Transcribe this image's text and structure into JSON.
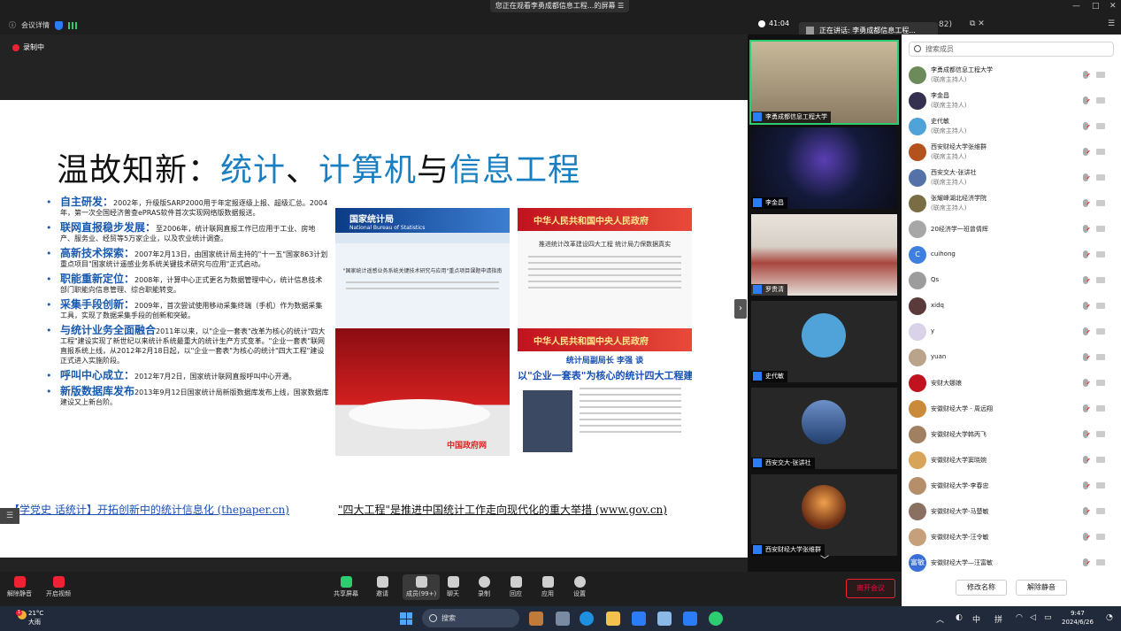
{
  "window": {
    "share_banner": "您正在观看李勇成都信息工程...的屏幕 ☰",
    "meeting_info_label": "会议详情",
    "timer": "41:04",
    "speaking": "正在讲话: 李勇成都信息工程...",
    "count": "82)",
    "min": "—",
    "max": "□",
    "close": "✕",
    "popout": "⧉ ✕"
  },
  "recording": {
    "label": "录制中"
  },
  "slide": {
    "title_parts": [
      "温故知新：",
      "统计",
      "、",
      "计算机",
      "与",
      "信息工程"
    ],
    "bullets": [
      {
        "head": "自主研发：",
        "text": "2002年，升级版SARP2000用于年定报逐级上报、超级汇总。2004年，第一次全国经济普查ePRAS软件首次实现网络版数据报送。"
      },
      {
        "head": "联网直报稳步发展：",
        "text": "至2006年，统计联网直报工作已应用于工业、房地产、服务业、经贸等5万家企业，以及农业统计调查。"
      },
      {
        "head": "高新技术探索：",
        "text": "2007年2月13日，由国家统计局主持的\"十一五\"国家863计划重点项目\"国家统计遥感业务系统关键技术研究与应用\"正式启动。"
      },
      {
        "head": "职能重新定位：",
        "text": "2008年，计算中心正式更名为数据管理中心，统计信息技术部门职能向信息管理、综合职能转变。"
      },
      {
        "head": "采集手段创新：",
        "text": "2009年，首次尝试使用移动采集终端（手机）作为数据采集工具，实现了数据采集手段的创新和突破。"
      },
      {
        "head": "与统计业务全面融合",
        "text": "2011年以来，以\"企业一套表\"改革为核心的统计\"四大工程\"建设实现了新世纪以来统计系统最重大的统计生产方式变革。\"企业一套表\"联网直报系统上线，从2012年2月18日起，以\"企业一套表\"为核心的统计\"四大工程\"建设正式进入实施阶段。"
      },
      {
        "head": "呼叫中心成立：",
        "text": "2012年7月2日，国家统计联网直报呼叫中心开通。"
      },
      {
        "head": "新版数据库发布",
        "text": "2013年9月12日国家统计局新版数据库发布上线，国家数据库建设又上新台阶。"
      }
    ],
    "img_a": {
      "header": "国家统计局",
      "subheader": "National Bureau of Statistics",
      "caption": "\"国家统计遥感业务系统关键技术研究与应用\"重点项目课题申请指南"
    },
    "img_b": {
      "header": "中华人民共和国中央人民政府",
      "title": "推进统计改革建设四大工程 统计局力保数据真实"
    },
    "img_c": {
      "logo": "中国政府网"
    },
    "img_d": {
      "header": "中华人民共和国中央人民政府",
      "line1": "统计局副局长 李强 谈",
      "line2": "以\"企业一套表\"为核心的统计四大工程建"
    },
    "link1": "【学党史 话统计】开拓创新中的统计信息化 (thepaper.cn)",
    "link2": "\"四大工程\"是推进中国统计工作走向现代化的重大举措 (www.gov.cn)"
  },
  "videos": [
    {
      "name": "李勇成都信息工程大学"
    },
    {
      "name": "李金昌"
    },
    {
      "name": "罗贵清"
    },
    {
      "name": "史代敏"
    },
    {
      "name": "西安交大-张讲社"
    },
    {
      "name": "西安财经大学张维群"
    }
  ],
  "panel": {
    "search_placeholder": "搜索成员",
    "members": [
      {
        "name": "李勇成都信息工程大学",
        "role": "(联席主持人)",
        "av": "#6d8b5a",
        "t": ""
      },
      {
        "name": "李金昌",
        "role": "(联席主持人)",
        "av": "#34304f",
        "t": ""
      },
      {
        "name": "史代敏",
        "role": "(联席主持人)",
        "av": "#4fa3d9",
        "t": ""
      },
      {
        "name": "西安财经大学张维群",
        "role": "(联席主持人)",
        "av": "#b4521d",
        "t": ""
      },
      {
        "name": "西安交大-张讲社",
        "role": "(联席主持人)",
        "av": "#5472a8",
        "t": ""
      },
      {
        "name": "张耀峰湖北经济学院",
        "role": "(联席主持人)",
        "av": "#7a6c45",
        "t": ""
      },
      {
        "name": "20经济学一班曾倩辉",
        "role": "",
        "av": "#a7a7a7",
        "t": ""
      },
      {
        "name": "cuihong",
        "role": "",
        "av": "#3f7fe0",
        "t": "C"
      },
      {
        "name": "Qs",
        "role": "",
        "av": "#9c9c9c",
        "t": ""
      },
      {
        "name": "xidq",
        "role": "",
        "av": "#5a3a3a",
        "t": ""
      },
      {
        "name": "y",
        "role": "",
        "av": "#d9d2e8",
        "t": ""
      },
      {
        "name": "yuan",
        "role": "",
        "av": "#b9a38a",
        "t": ""
      },
      {
        "name": "安财大娜娘",
        "role": "",
        "av": "#c1121f",
        "t": ""
      },
      {
        "name": "安徽财经大学 - 周远翔",
        "role": "",
        "av": "#c98a3a",
        "t": ""
      },
      {
        "name": "安徽财经大学韩丙飞",
        "role": "",
        "av": "#a08060",
        "t": ""
      },
      {
        "name": "安徽财经大学窦晓婉",
        "role": "",
        "av": "#d7a45a",
        "t": ""
      },
      {
        "name": "安徽财经大学-李春忠",
        "role": "",
        "av": "#b58f6a",
        "t": ""
      },
      {
        "name": "安徽财经大学-马楚敏",
        "role": "",
        "av": "#8a7060",
        "t": ""
      },
      {
        "name": "安徽财经大学-汪令敏",
        "role": "",
        "av": "#c6a07a",
        "t": ""
      },
      {
        "name": "安徽财经大学—汪富敏",
        "role": "",
        "av": "#3a6fd8",
        "t": "富敏"
      }
    ],
    "rename_btn": "修改名称",
    "unmute_btn": "解除静音"
  },
  "toolbar": {
    "mute": "解除静音",
    "video": "开启视频",
    "share": "共享屏幕",
    "invite": "邀请",
    "members": "成员(99+)",
    "chat": "聊天",
    "record": "录制",
    "reaction": "回应",
    "apps": "应用",
    "settings": "设置",
    "leave": "离开会议"
  },
  "taskbar": {
    "temp": "21°C",
    "weather": "大雨",
    "badge": "1",
    "search": "搜索",
    "ime_zh": "中",
    "ime_py": "拼",
    "time": "9:47",
    "date": "2024/6/26"
  }
}
